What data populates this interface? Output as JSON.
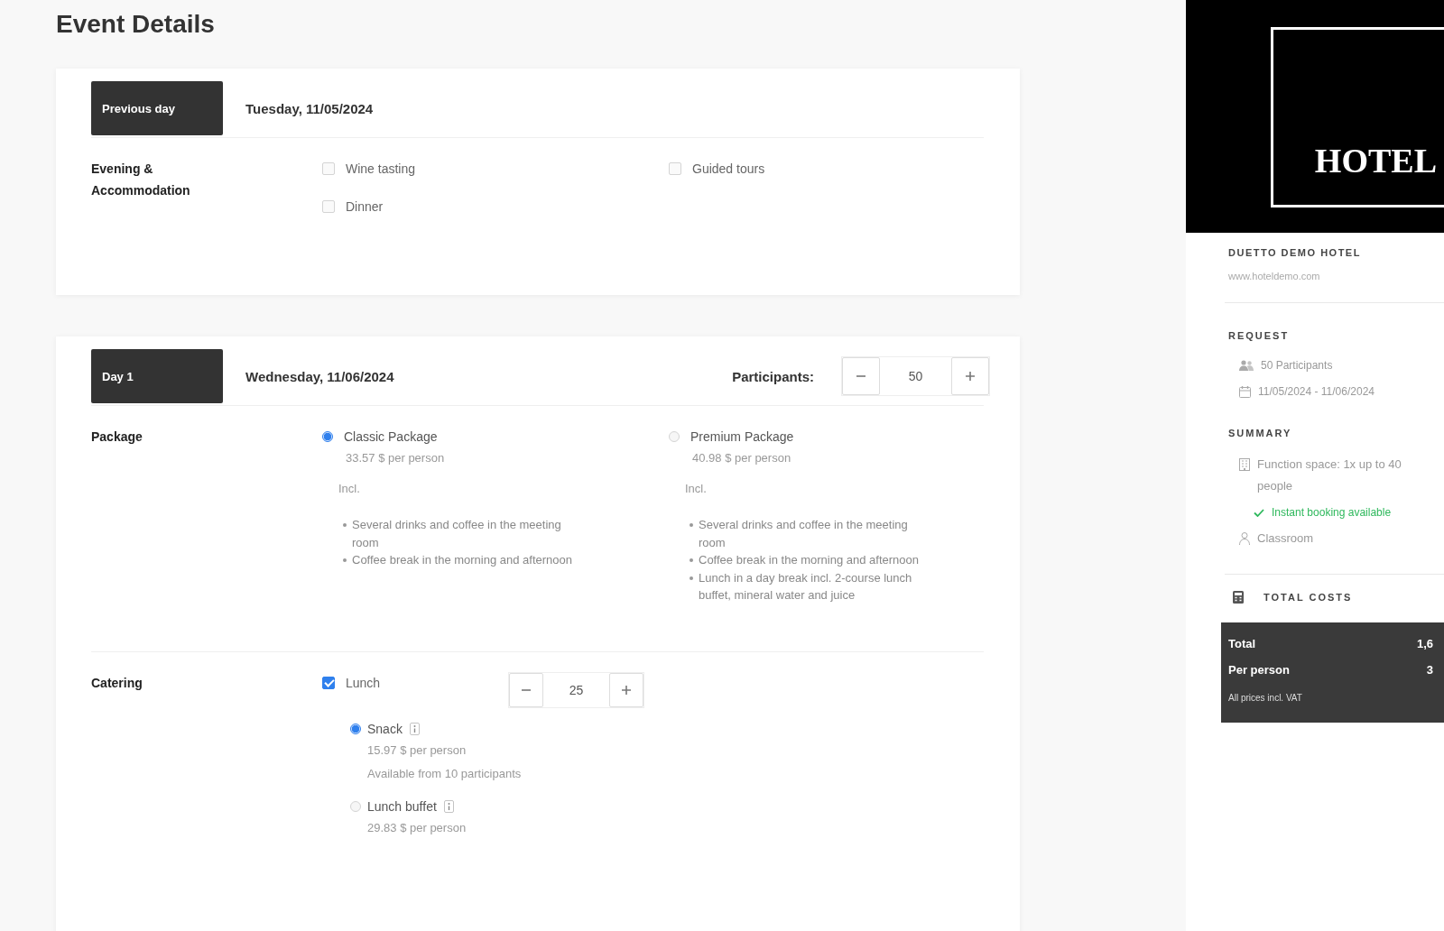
{
  "page": {
    "title": "Event Details"
  },
  "days": [
    {
      "badge": "Previous day",
      "date": "Tuesday, 11/05/2024",
      "sections": [
        {
          "kind": "checks",
          "label": "Evening & Accommodation",
          "options": [
            {
              "label": "Wine tasting",
              "checked": false
            },
            {
              "label": "Guided tours",
              "checked": false
            },
            {
              "label": "Dinner",
              "checked": false
            }
          ]
        }
      ]
    },
    {
      "badge": "Day 1",
      "date": "Wednesday, 11/06/2024",
      "participants": {
        "label": "Participants:",
        "value": "50"
      },
      "sections": [
        {
          "kind": "packages",
          "label": "Package",
          "options": [
            {
              "name": "Classic Package",
              "price": "33.57 $ per person",
              "included_label": "Incl.",
              "items": [
                "Several drinks and coffee in the meeting room",
                "Coffee break in the morning and afternoon"
              ],
              "selected": true
            },
            {
              "name": "Premium Package",
              "price": "40.98 $ per person",
              "included_label": "Incl.",
              "items": [
                "Several drinks and coffee in the meeting room",
                "Coffee break in the morning and afternoon",
                "Lunch in a day break incl. 2-course lunch buffet, mineral water and juice"
              ],
              "selected": false
            }
          ]
        },
        {
          "kind": "catering",
          "label": "Catering",
          "option": {
            "label": "Lunch",
            "checked": true,
            "value": "25"
          },
          "choices": [
            {
              "name": "Snack",
              "price": "15.97 $ per person",
              "note": "Available from 10 participants",
              "selected": true
            },
            {
              "name": "Lunch buffet",
              "price": "29.83 $ per person",
              "selected": false
            }
          ]
        }
      ]
    }
  ],
  "sidebar": {
    "logo_text": "HOTEL",
    "hotel_name": "DUETTO DEMO HOTEL",
    "website": "www.hoteldemo.com",
    "sections": [
      {
        "heading": "REQUEST",
        "rows": [
          {
            "kind": "people",
            "text": "50 Participants"
          },
          {
            "kind": "calendar",
            "text": "11/05/2024 - 11/06/2024"
          }
        ]
      },
      {
        "heading": "SUMMARY",
        "rows": [
          {
            "kind": "room",
            "text": "Function space: 1x up to 40 people"
          },
          {
            "kind": "ok",
            "text": "Instant booking available"
          },
          {
            "kind": "seating",
            "text": "Classroom"
          }
        ]
      }
    ],
    "total_costs": {
      "heading": "TOTAL COSTS",
      "rows": [
        {
          "label": "Total",
          "value": "1,6"
        },
        {
          "label": "Per person",
          "value": "3"
        }
      ],
      "note": "All prices incl. VAT"
    }
  }
}
